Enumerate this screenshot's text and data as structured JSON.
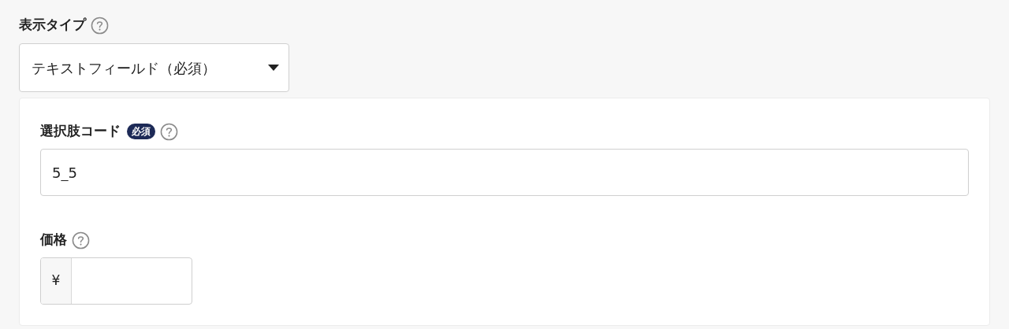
{
  "display_type": {
    "label": "表示タイプ",
    "value": "テキストフィールド（必須）"
  },
  "panel": {
    "fields": [
      {
        "kind": "text",
        "label": "選択肢コード",
        "badge": "必須",
        "value": "5_5"
      },
      {
        "kind": "currency",
        "label": "価格",
        "prefix": "¥"
      }
    ]
  }
}
